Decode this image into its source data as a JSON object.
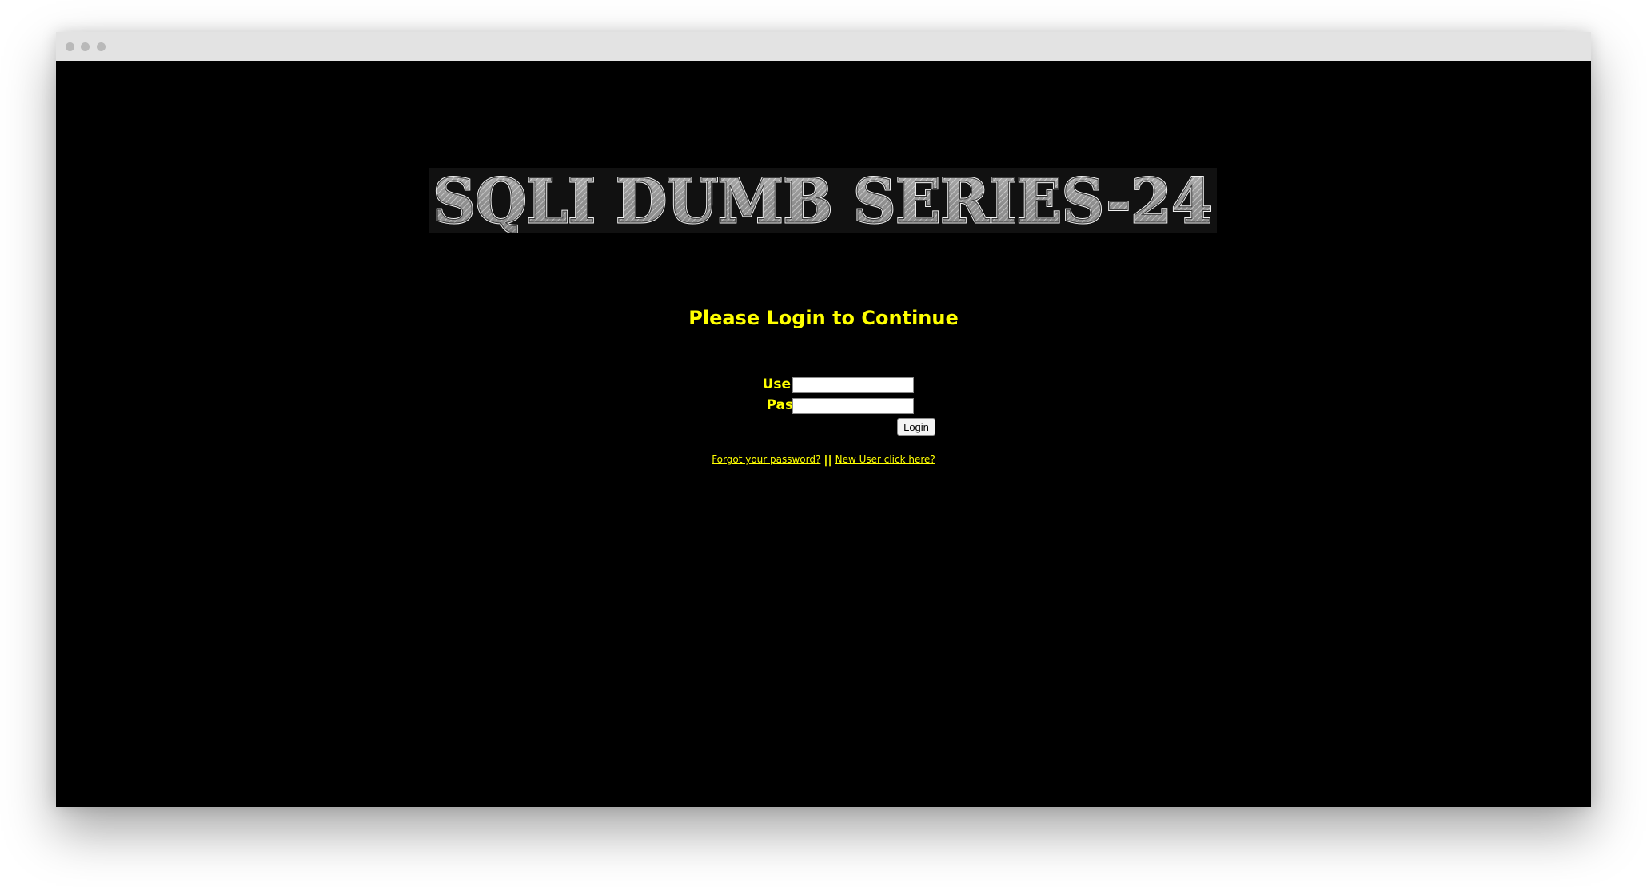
{
  "page": {
    "banner_text": "SQLI DUMB SERIES-24",
    "heading": "Please Login to Continue"
  },
  "form": {
    "username_label": "Username:",
    "password_label": "Password:",
    "username_value": "",
    "password_value": "",
    "login_button": "Login"
  },
  "links": {
    "forgot_password": "Forgot your password?",
    "separator": "||",
    "new_user": "New User click here?"
  },
  "colors": {
    "background": "#000000",
    "accent_text": "#ffff00",
    "titlebar": "#e3e3e3"
  }
}
